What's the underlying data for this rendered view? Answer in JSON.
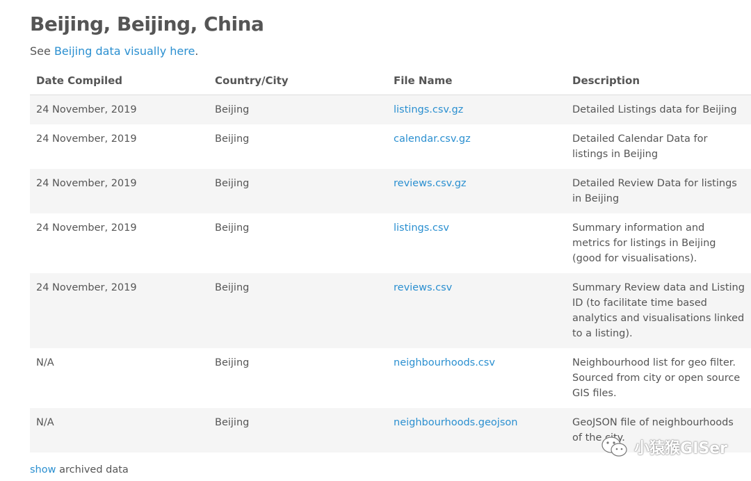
{
  "header": {
    "title": "Beijing, Beijing, China",
    "see_prefix": "See ",
    "see_link": "Beijing data visually here",
    "see_suffix": "."
  },
  "table": {
    "columns": [
      "Date Compiled",
      "Country/City",
      "File Name",
      "Description"
    ],
    "rows": [
      {
        "date": "24 November, 2019",
        "city": "Beijing",
        "file": "listings.csv.gz",
        "description": "Detailed Listings data for Beijing"
      },
      {
        "date": "24 November, 2019",
        "city": "Beijing",
        "file": "calendar.csv.gz",
        "description": "Detailed Calendar Data for listings in Beijing"
      },
      {
        "date": "24 November, 2019",
        "city": "Beijing",
        "file": "reviews.csv.gz",
        "description": "Detailed Review Data for listings in Beijing"
      },
      {
        "date": "24 November, 2019",
        "city": "Beijing",
        "file": "listings.csv",
        "description": "Summary information and metrics for listings in Beijing (good for visualisations)."
      },
      {
        "date": "24 November, 2019",
        "city": "Beijing",
        "file": "reviews.csv",
        "description": "Summary Review data and Listing ID (to facilitate time based analytics and visualisations linked to a listing)."
      },
      {
        "date": "N/A",
        "city": "Beijing",
        "file": "neighbourhoods.csv",
        "description": "Neighbourhood list for geo filter. Sourced from city or open source GIS files."
      },
      {
        "date": "N/A",
        "city": "Beijing",
        "file": "neighbourhoods.geojson",
        "description": "GeoJSON file of neighbourhoods of the city."
      }
    ]
  },
  "footer": {
    "show_link": "show",
    "suffix": " archived data"
  },
  "watermark": {
    "text": "小猿猴GISer",
    "icon": "wechat-icon"
  },
  "colors": {
    "link": "#2a8fd0",
    "text": "#555555",
    "stripe": "#f5f5f5"
  }
}
